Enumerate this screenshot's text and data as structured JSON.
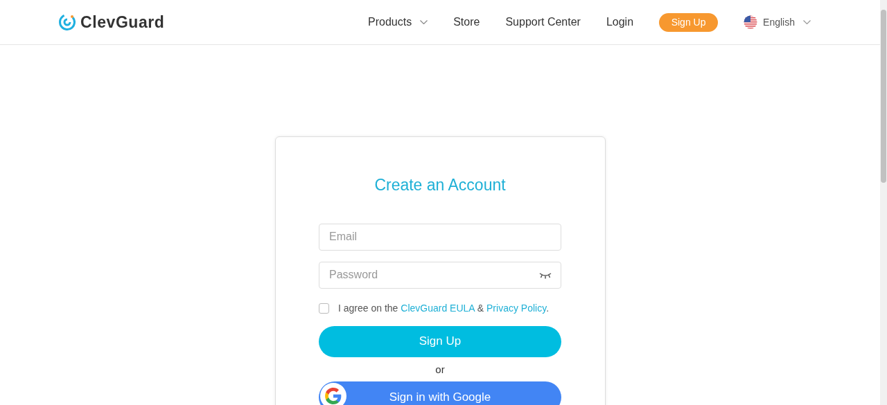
{
  "header": {
    "logo": "ClevGuard",
    "nav": [
      {
        "label": "Products",
        "kind": "dropdown"
      },
      {
        "label": "Store",
        "kind": "link"
      },
      {
        "label": "Support Center",
        "kind": "link"
      },
      {
        "label": "Login",
        "kind": "link"
      },
      {
        "label": "Sign Up",
        "kind": "button"
      },
      {
        "label": "English",
        "kind": "language"
      }
    ]
  },
  "form": {
    "title": "Create an Account",
    "fields": [
      {
        "placeholder": "Email",
        "kind": "email"
      },
      {
        "placeholder": "Password",
        "kind": "password"
      }
    ],
    "agreement": {
      "checked": false,
      "before": "I agree on the ",
      "eula_link": "ClevGuard EULA",
      "joiner": " & ",
      "privacy_link": "Privacy Policy",
      "end": "."
    },
    "submit": "Sign Up",
    "or": "or",
    "google": "Sign in with Google"
  }
}
